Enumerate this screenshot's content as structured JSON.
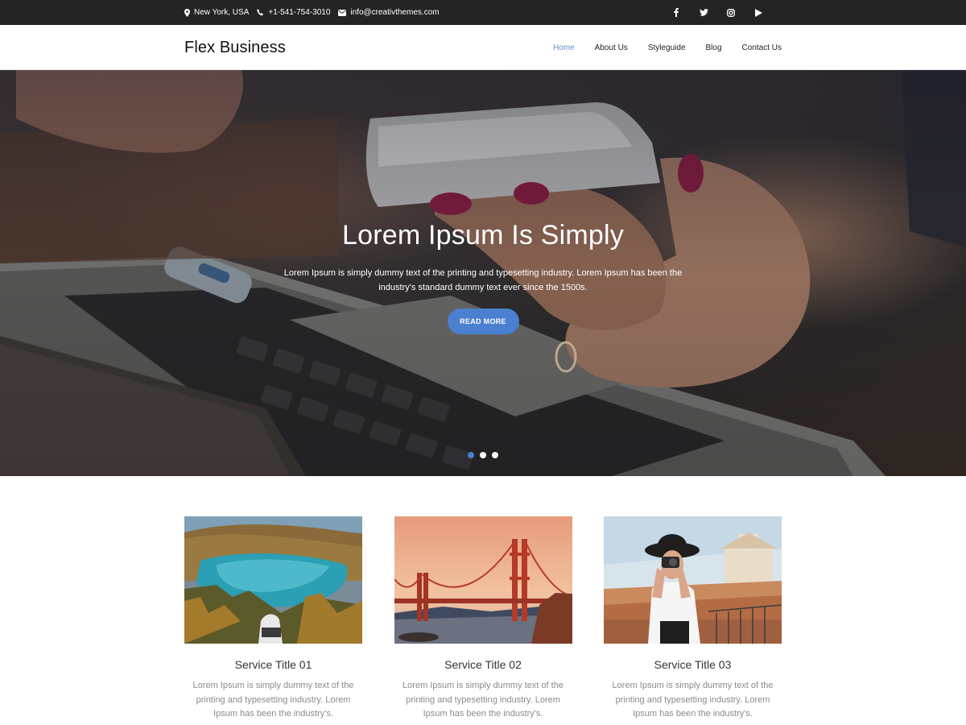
{
  "topbar": {
    "location": "New York, USA",
    "phone": "+1-541-754-3010",
    "email": "info@creativthemes.com",
    "socials": [
      "facebook-icon",
      "twitter-icon",
      "instagram-icon",
      "youtube-icon"
    ]
  },
  "header": {
    "logo": "Flex Business",
    "nav": [
      "Home",
      "About Us",
      "Styleguide",
      "Blog",
      "Contact Us"
    ],
    "active_nav": "Home"
  },
  "hero": {
    "title": "Lorem Ipsum Is Simply",
    "text": "Lorem Ipsum is simply dummy text of the printing and typesetting industry. Lorem Ipsum has been the industry's standard dummy text ever since the 1500s.",
    "button": "READ MORE",
    "slides": 3,
    "active_slide": 1
  },
  "services": [
    {
      "title": "Service Title 01",
      "text": "Lorem Ipsum is simply dummy text of the printing and typesetting industry. Lorem Ipsum has been the industry's."
    },
    {
      "title": "Service Title 02",
      "text": "Lorem Ipsum is simply dummy text of the printing and typesetting industry. Lorem Ipsum has been the industry's."
    },
    {
      "title": "Service Title 03",
      "text": "Lorem Ipsum is simply dummy text of the printing and typesetting industry. Lorem Ipsum has been the industry's."
    }
  ],
  "colors": {
    "accent": "#4a80cf",
    "nav_active": "#5b8fd0",
    "topbar": "#242424"
  }
}
